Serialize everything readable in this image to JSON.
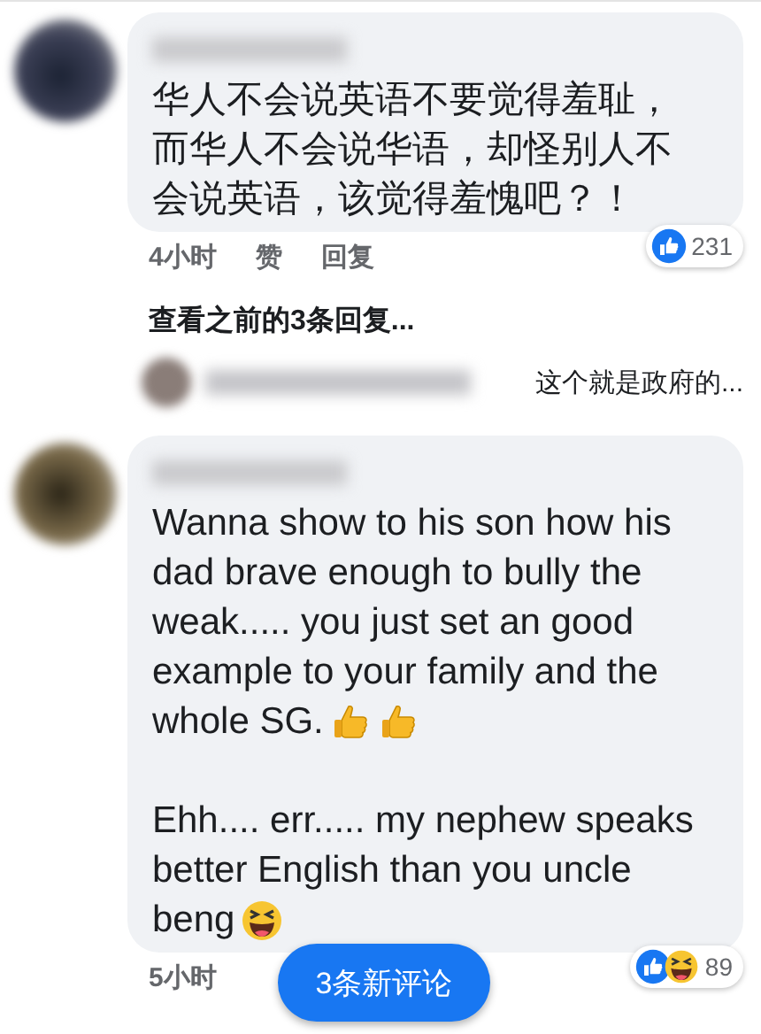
{
  "comments": [
    {
      "paragraphs": [
        {
          "lines": [
            "华人不会说英语不要觉得羞耻，",
            "而华人不会说华语，却怪别人不",
            "会说英语，该觉得羞愧吧？！"
          ]
        }
      ],
      "time": "4小时",
      "actions": [
        "赞",
        "回复"
      ],
      "reactions": [
        {
          "kind": "like"
        }
      ],
      "reaction_count": "231",
      "more_replies": "查看之前的3条回复...",
      "reply_preview": {
        "text": "这个就是政府的..."
      }
    },
    {
      "paragraphs": [
        {
          "lines": [
            "Wanna show to his son how his",
            "dad brave enough to bully the",
            "weak..... you just set an good",
            "example to your family and the",
            "whole SG."
          ],
          "emojis": [
            {
              "kind": "thumbs_up"
            },
            {
              "kind": "thumbs_up"
            }
          ]
        },
        {
          "lines": [
            "Ehh.... err..... my nephew speaks",
            "better English than you uncle",
            "beng"
          ],
          "emojis": [
            {
              "kind": "laughing"
            }
          ]
        }
      ],
      "time": "5小时",
      "reactions": [
        {
          "kind": "like"
        },
        {
          "kind": "haha"
        }
      ],
      "reaction_count": "89"
    }
  ],
  "new_comments_button": "3条新评论"
}
